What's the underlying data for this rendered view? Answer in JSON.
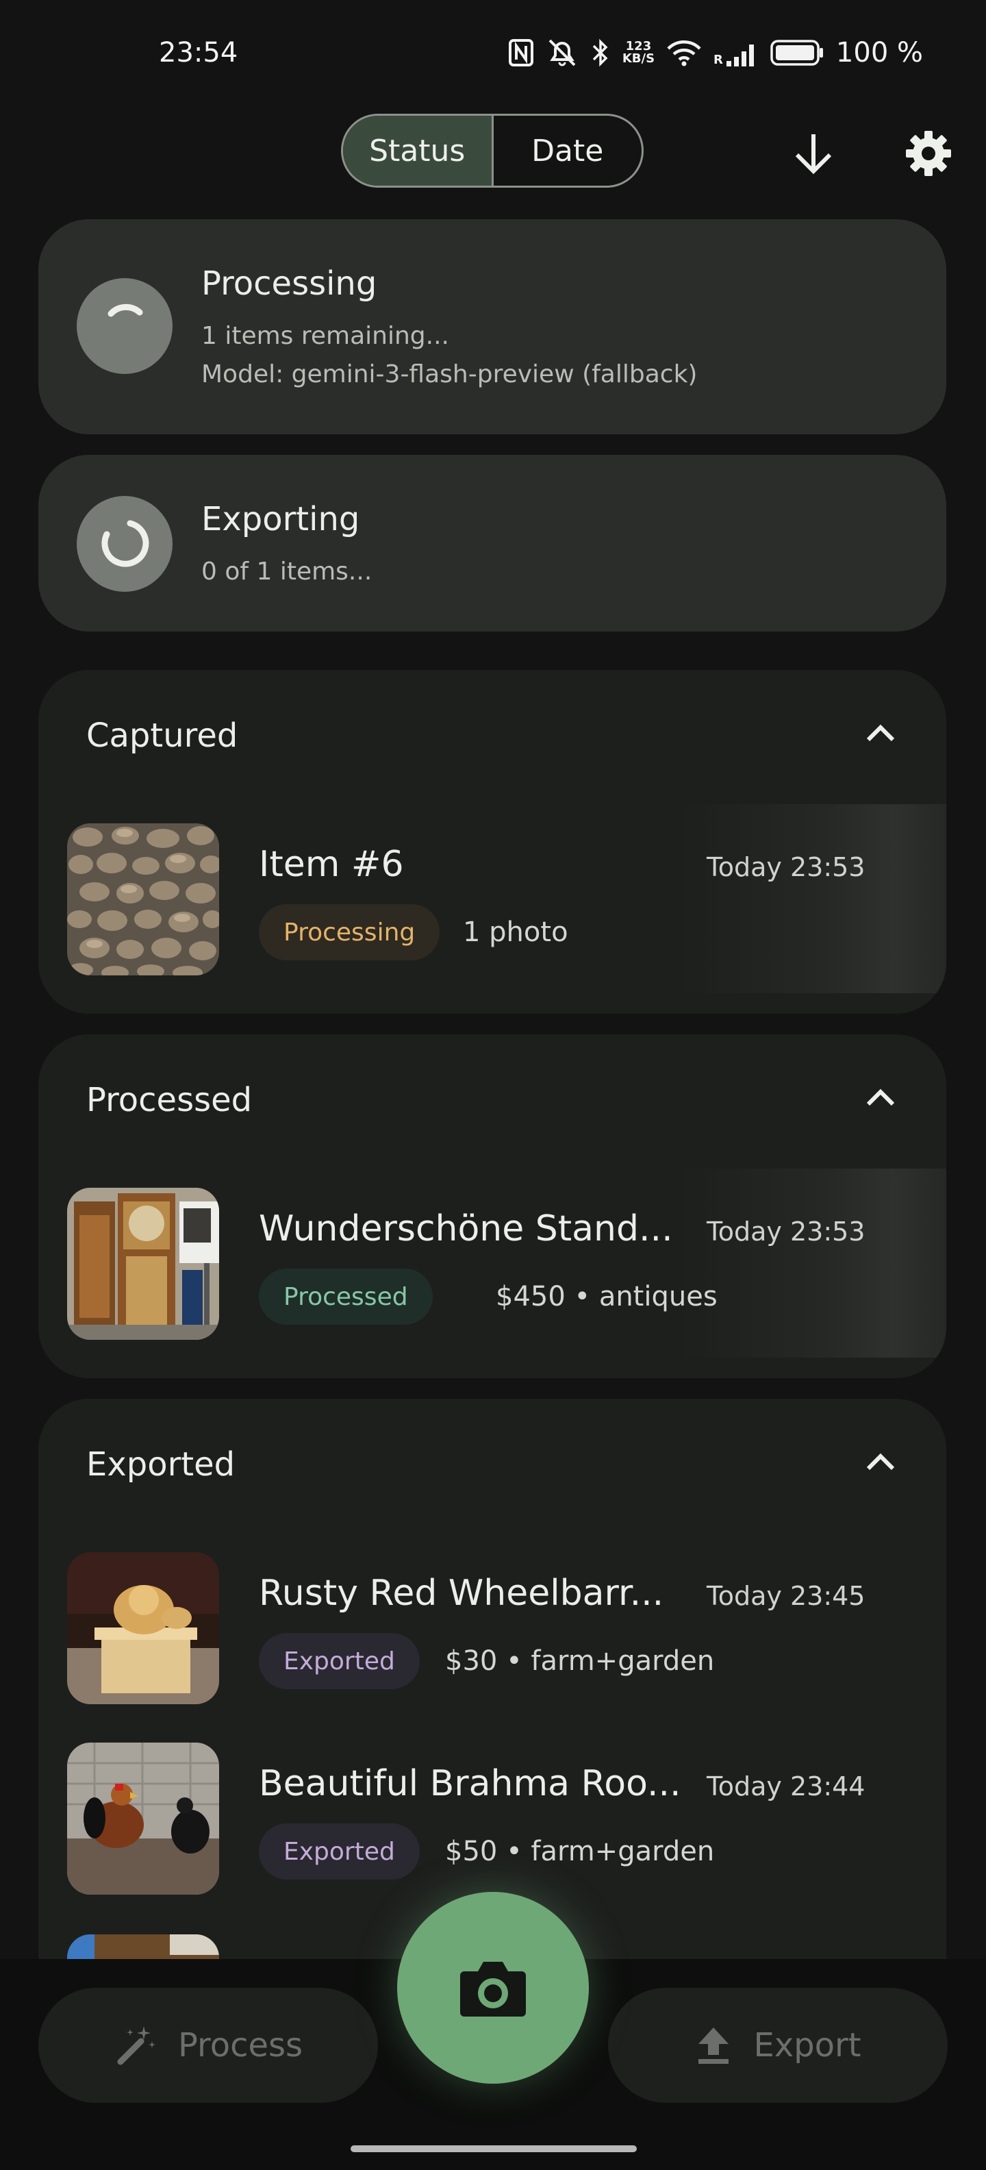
{
  "status_bar": {
    "time": "23:54",
    "network_speed_top": "123",
    "network_speed_bottom": "KB/S",
    "signal_label": "R",
    "battery": "100 %"
  },
  "header": {
    "tabs": [
      {
        "label": "Status",
        "active": true
      },
      {
        "label": "Date",
        "active": false
      }
    ],
    "download_icon": "arrow-down-icon",
    "settings_icon": "gear-icon"
  },
  "processing_card": {
    "title": "Processing",
    "line1": "1 items remaining...",
    "line2": "Model: gemini-3-flash-preview (fallback)"
  },
  "exporting_card": {
    "title": "Exporting",
    "line1": "0 of 1 items..."
  },
  "sections": {
    "captured": {
      "title": "Captured",
      "items": [
        {
          "title": "Item #6",
          "time": "Today 23:53",
          "badge": "Processing",
          "meta": "1 photo"
        }
      ]
    },
    "processed": {
      "title": "Processed",
      "items": [
        {
          "title": "Wunderschöne Stand...",
          "time": "Today 23:53",
          "badge": "Processed",
          "meta": "$450 • antiques"
        }
      ]
    },
    "exported": {
      "title": "Exported",
      "items": [
        {
          "title": "Rusty Red Wheelbarr...",
          "time": "Today 23:45",
          "badge": "Exported",
          "meta": "$30 • farm+garden"
        },
        {
          "title": "Beautiful Brahma Roo...",
          "time": "Today 23:44",
          "badge": "Exported",
          "meta": "$50 • farm+garden"
        }
      ]
    }
  },
  "bottom_bar": {
    "process_label": "Process",
    "export_label": "Export",
    "camera_icon": "camera-icon"
  },
  "colors": {
    "background": "#121312",
    "accent_green": "#6ea876",
    "processing_badge": "#e4b36a",
    "processed_badge": "#86c8a8",
    "exported_badge": "#c3acd9"
  }
}
